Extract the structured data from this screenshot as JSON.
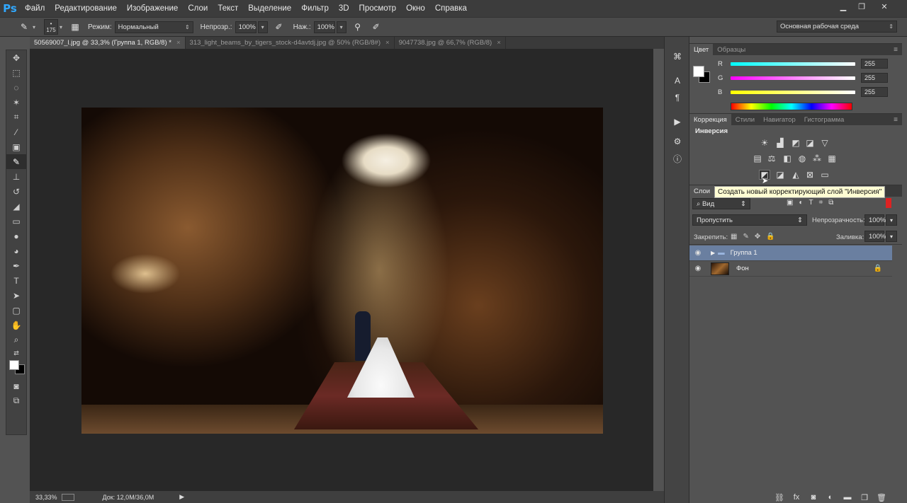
{
  "app": {
    "logo": "Ps"
  },
  "menu": [
    "Файл",
    "Редактирование",
    "Изображение",
    "Слои",
    "Текст",
    "Выделение",
    "Фильтр",
    "3D",
    "Просмотр",
    "Окно",
    "Справка"
  ],
  "options": {
    "brush_size": "175",
    "mode_label": "Режим:",
    "mode_value": "Нормальный",
    "opacity_label": "Непрозр.:",
    "opacity_value": "100%",
    "pressure_label": "Наж.:",
    "pressure_value": "100%",
    "workspace": "Основная рабочая среда"
  },
  "tabs": [
    {
      "label": "50569007_l.jpg @ 33,3% (Группа 1, RGB/8) *",
      "active": true
    },
    {
      "label": "313_light_beams_by_tigers_stock-d4avtdj.jpg @ 50% (RGB/8#)",
      "active": false
    },
    {
      "label": "9047738.jpg @ 66,7% (RGB/8)",
      "active": false
    }
  ],
  "status": {
    "zoom": "33,33%",
    "doc": "Док: 12,0M/36,0M"
  },
  "color_panel": {
    "tabs": [
      "Цвет",
      "Образцы"
    ],
    "channels": [
      {
        "label": "R",
        "value": "255"
      },
      {
        "label": "G",
        "value": "255"
      },
      {
        "label": "B",
        "value": "255"
      }
    ]
  },
  "adjust_panel": {
    "tabs": [
      "Коррекция",
      "Стили",
      "Навигатор",
      "Гистограмма"
    ],
    "heading": "Инверсия",
    "tooltip": "Создать новый корректирующий слой \"Инверсия\""
  },
  "layers_panel": {
    "tab": "Слои",
    "filter": "Вид",
    "blend": "Пропустить",
    "opacity_label": "Непрозрачность:",
    "opacity_value": "100%",
    "lock_label": "Закрепить:",
    "fill_label": "Заливка:",
    "fill_value": "100%",
    "layers": [
      {
        "name": "Группа 1",
        "type": "group",
        "selected": true
      },
      {
        "name": "Фон",
        "type": "image",
        "selected": false
      }
    ]
  }
}
